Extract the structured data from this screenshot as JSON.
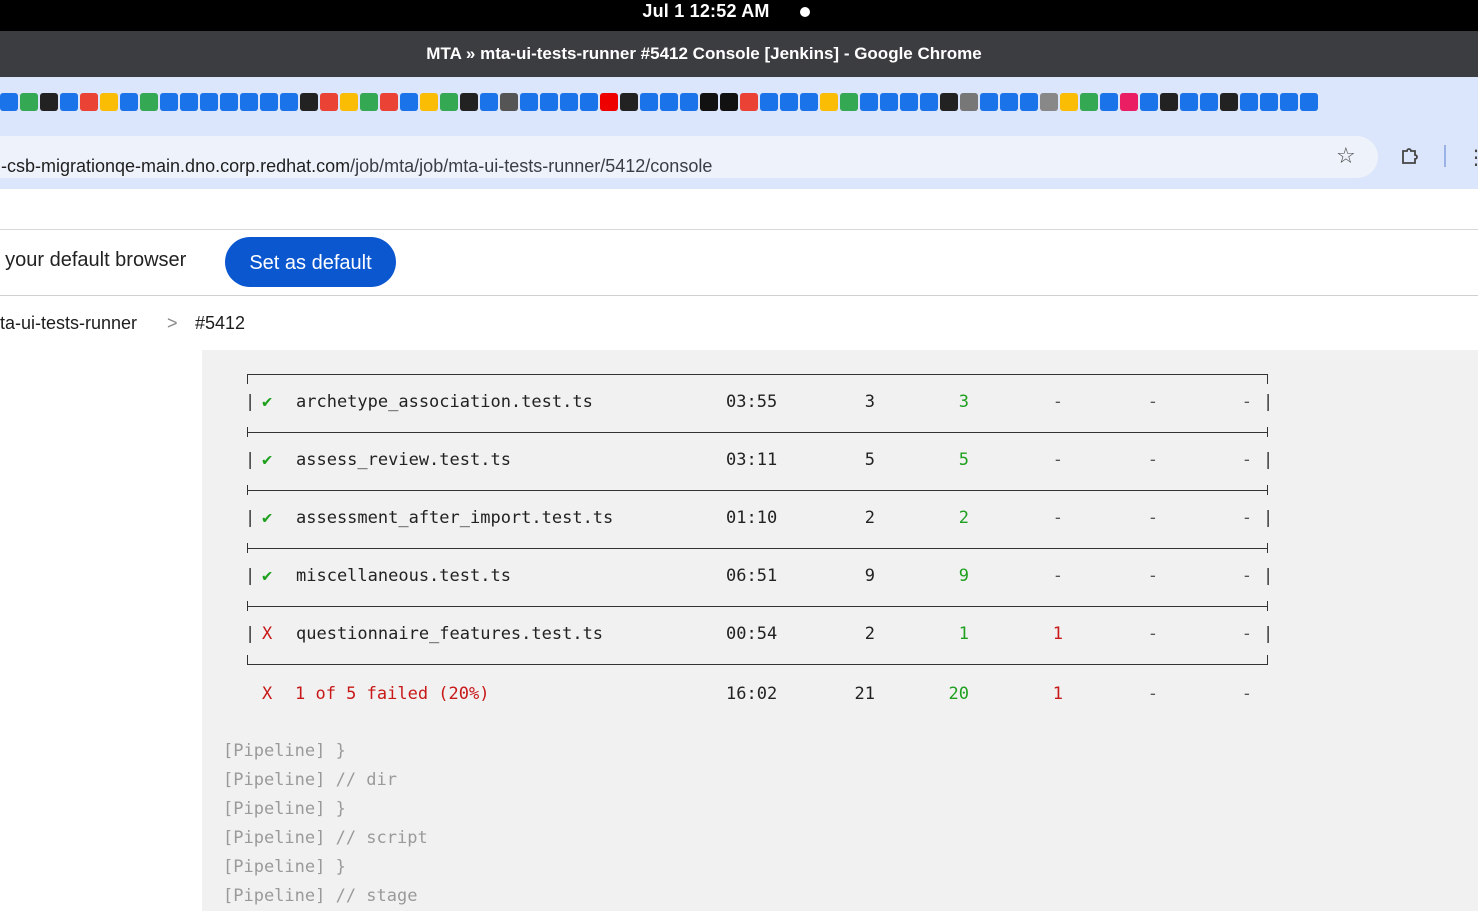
{
  "os": {
    "datetime": "Jul 1  12:52 AM"
  },
  "window": {
    "title": "MTA » mta-ui-tests-runner #5412 Console [Jenkins] - Google Chrome"
  },
  "bookmarks_colors": [
    "#1a73e8",
    "#34a853",
    "#222222",
    "#1a73e8",
    "#ea4335",
    "#fbbc04",
    "#1a73e8",
    "#34a853",
    "#1a73e8",
    "#1a73e8",
    "#1a73e8",
    "#1a73e8",
    "#1a73e8",
    "#1a73e8",
    "#1a73e8",
    "#222222",
    "#ea4335",
    "#fbbc04",
    "#34a853",
    "#ea4335",
    "#1a73e8",
    "#fbbc04",
    "#34a853",
    "#222222",
    "#1a73e8",
    "#555555",
    "#1a73e8",
    "#1a73e8",
    "#1a73e8",
    "#1a73e8",
    "#ee0000",
    "#222222",
    "#1a73e8",
    "#1a73e8",
    "#1a73e8",
    "#111111",
    "#111111",
    "#ea4335",
    "#1a73e8",
    "#1a73e8",
    "#1a73e8",
    "#fbbc04",
    "#34a853",
    "#1a73e8",
    "#1a73e8",
    "#1a73e8",
    "#1a73e8",
    "#222222",
    "#777777",
    "#1a73e8",
    "#1a73e8",
    "#1a73e8",
    "#888888",
    "#fbbc04",
    "#34a853",
    "#1a73e8",
    "#e91e63",
    "#1a73e8",
    "#222222",
    "#1a73e8",
    "#1a73e8",
    "#222222",
    "#1a73e8",
    "#1a73e8",
    "#1a73e8",
    "#1a73e8"
  ],
  "address": {
    "host": "-csb-migrationqe-main.dno.corp.redhat.com",
    "path": "/job/mta/job/mta-ui-tests-runner/5412/console"
  },
  "icons": {
    "star": "star-icon",
    "extensions": "puzzle-icon",
    "more": "menu-icon"
  },
  "infobar": {
    "message": "t your default browser",
    "button": "Set as default"
  },
  "breadcrumb": {
    "job": "ta-ui-tests-runner",
    "separator": ">",
    "build": "#5412"
  },
  "results": {
    "rows": [
      {
        "status": "pass",
        "mark": "✔",
        "spec": "archetype_association.test.ts",
        "duration": "03:55",
        "tests": "3",
        "passing": "3",
        "failing": "-",
        "pending": "-",
        "skipped": "-"
      },
      {
        "status": "pass",
        "mark": "✔",
        "spec": "assess_review.test.ts",
        "duration": "03:11",
        "tests": "5",
        "passing": "5",
        "failing": "-",
        "pending": "-",
        "skipped": "-"
      },
      {
        "status": "pass",
        "mark": "✔",
        "spec": "assessment_after_import.test.ts",
        "duration": "01:10",
        "tests": "2",
        "passing": "2",
        "failing": "-",
        "pending": "-",
        "skipped": "-"
      },
      {
        "status": "pass",
        "mark": "✔",
        "spec": "miscellaneous.test.ts",
        "duration": "06:51",
        "tests": "9",
        "passing": "9",
        "failing": "-",
        "pending": "-",
        "skipped": "-"
      },
      {
        "status": "fail",
        "mark": "X",
        "spec": "questionnaire_features.test.ts",
        "duration": "00:54",
        "tests": "2",
        "passing": "1",
        "failing": "1",
        "pending": "-",
        "skipped": "-"
      }
    ],
    "summary": {
      "mark": "X",
      "text": "1 of 5 failed (20%)",
      "duration": "16:02",
      "tests": "21",
      "passing": "20",
      "failing": "1",
      "pending": "-",
      "skipped": "-"
    }
  },
  "pipeline_lines": [
    "[Pipeline] }",
    "[Pipeline] // dir",
    "[Pipeline] }",
    "[Pipeline] // script",
    "[Pipeline] }",
    "[Pipeline] // stage"
  ]
}
